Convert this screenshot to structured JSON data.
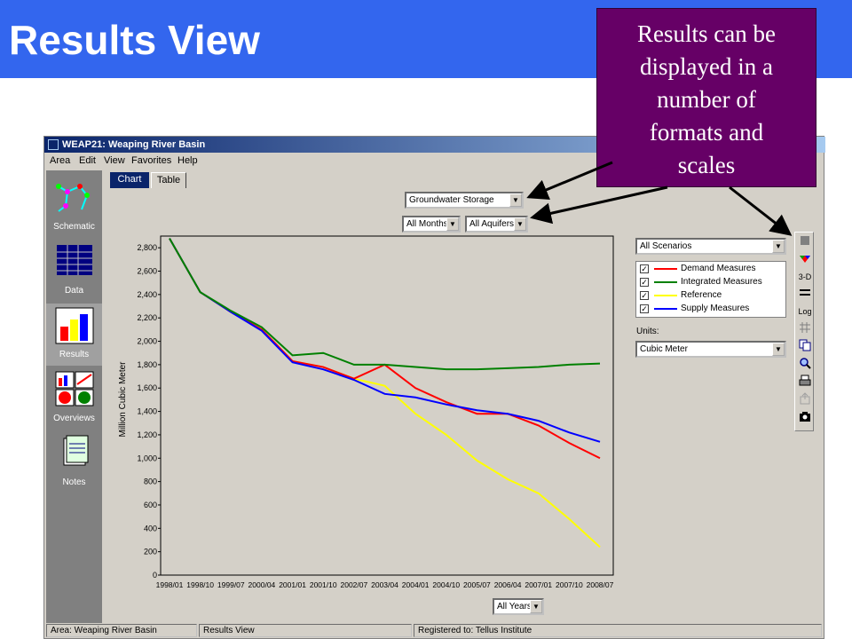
{
  "slide": {
    "title": "Results View",
    "callout_lines": [
      "Results can be",
      "displayed in a",
      "number of",
      "formats and",
      "scales"
    ]
  },
  "window": {
    "title": "WEAP21: Weaping River Basin",
    "menu": [
      "Area",
      "Edit",
      "View",
      "Favorites",
      "Help"
    ]
  },
  "sidebar": {
    "items": [
      {
        "label": "Schematic",
        "icon": "schematic-icon"
      },
      {
        "label": "Data",
        "icon": "data-icon"
      },
      {
        "label": "Results",
        "icon": "results-icon"
      },
      {
        "label": "Overviews",
        "icon": "overviews-icon"
      },
      {
        "label": "Notes",
        "icon": "notes-icon"
      }
    ]
  },
  "tabs": [
    "Chart",
    "Table"
  ],
  "controls": {
    "variable": "Groundwater Storage",
    "months": "All Months",
    "aquifers": "All Aquifers",
    "years": "All Years",
    "scenarios": "All Scenarios",
    "units_label": "Units:",
    "units": "Cubic Meter"
  },
  "toolbar": {
    "tools": [
      "bar-chart-icon",
      "palette-icon",
      "3-D",
      "line-style-icon",
      "Log",
      "grid-icon",
      "copy-icon",
      "zoom-icon",
      "print-icon",
      "export-icon",
      "camera-icon"
    ]
  },
  "status": {
    "area": "Area: Weaping River Basin",
    "view": "Results View",
    "registered": "Registered to: Tellus Institute"
  },
  "colors": {
    "title_bar": "#3366ee",
    "callout": "#660066",
    "chart_bg": "#d4d0c8"
  },
  "chart_data": {
    "type": "line",
    "title": "",
    "xlabel": "",
    "ylabel": "Million Cubic Meter",
    "ylim": [
      0,
      2900
    ],
    "x": [
      "1998/01",
      "1998/10",
      "1999/07",
      "2000/04",
      "2001/01",
      "2001/10",
      "2002/07",
      "2003/04",
      "2004/01",
      "2004/10",
      "2005/07",
      "2006/04",
      "2007/01",
      "2007/10",
      "2008/07"
    ],
    "yticks": [
      0,
      200,
      400,
      600,
      800,
      1000,
      1200,
      1400,
      1600,
      1800,
      2000,
      2200,
      2400,
      2600,
      2800
    ],
    "xtick_labels": [
      "1998/01",
      "1998/10",
      "1999/07",
      "2000/04",
      "2001/01",
      "2001/10",
      "2002/07",
      "2003/04",
      "2004/01",
      "2004/10",
      "2005/07",
      "2006/04",
      "2007/01",
      "2007/10",
      "2008/07"
    ],
    "series": [
      {
        "name": "Demand Measures",
        "color": "#ff0000",
        "values": [
          2880,
          2420,
          2250,
          2100,
          1830,
          1780,
          1680,
          1800,
          1600,
          1480,
          1380,
          1380,
          1280,
          1130,
          1000
        ]
      },
      {
        "name": "Integrated Measures",
        "color": "#008000",
        "values": [
          2880,
          2420,
          2260,
          2120,
          1880,
          1900,
          1800,
          1800,
          1780,
          1760,
          1760,
          1770,
          1780,
          1800,
          1810
        ]
      },
      {
        "name": "Reference",
        "color": "#ffff00",
        "values": [
          2880,
          2420,
          2250,
          2100,
          1830,
          1780,
          1680,
          1620,
          1380,
          1200,
          980,
          820,
          700,
          480,
          240
        ]
      },
      {
        "name": "Supply Measures",
        "color": "#0000ff",
        "values": [
          2880,
          2420,
          2250,
          2090,
          1820,
          1760,
          1670,
          1550,
          1520,
          1460,
          1410,
          1380,
          1320,
          1220,
          1140
        ]
      }
    ]
  }
}
